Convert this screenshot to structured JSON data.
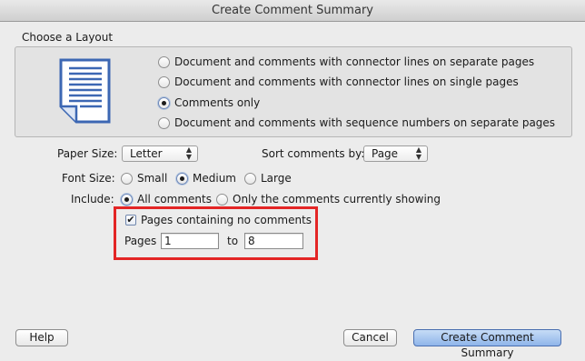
{
  "window": {
    "title": "Create Comment Summary"
  },
  "layout": {
    "group_label": "Choose a Layout",
    "options": [
      {
        "label": "Document and comments with connector lines on separate pages",
        "selected": false
      },
      {
        "label": "Document and comments with connector lines on single pages",
        "selected": false
      },
      {
        "label": "Comments only",
        "selected": true
      },
      {
        "label": "Document and comments with sequence numbers on separate pages",
        "selected": false
      }
    ],
    "icon": "document-icon"
  },
  "paper_size": {
    "label": "Paper Size:",
    "value": "Letter"
  },
  "sort": {
    "label": "Sort comments by:",
    "value": "Page"
  },
  "font_size": {
    "label": "Font Size:",
    "options": [
      {
        "label": "Small",
        "selected": false
      },
      {
        "label": "Medium",
        "selected": true
      },
      {
        "label": "Large",
        "selected": false
      }
    ]
  },
  "include": {
    "label": "Include:",
    "options": [
      {
        "label": "All comments",
        "selected": true
      },
      {
        "label": "Only the comments currently showing",
        "selected": false
      }
    ]
  },
  "pages_no_comments": {
    "label": "Pages containing no comments",
    "checked": true
  },
  "pages_range": {
    "label": "Pages",
    "from": "1",
    "to_label": "to",
    "to": "8"
  },
  "buttons": {
    "help": "Help",
    "cancel": "Cancel",
    "create": "Create Comment Summary"
  },
  "colors": {
    "highlight": "#e32525",
    "default_button": "#8fb5ea",
    "icon_blue": "#3c67b3"
  }
}
